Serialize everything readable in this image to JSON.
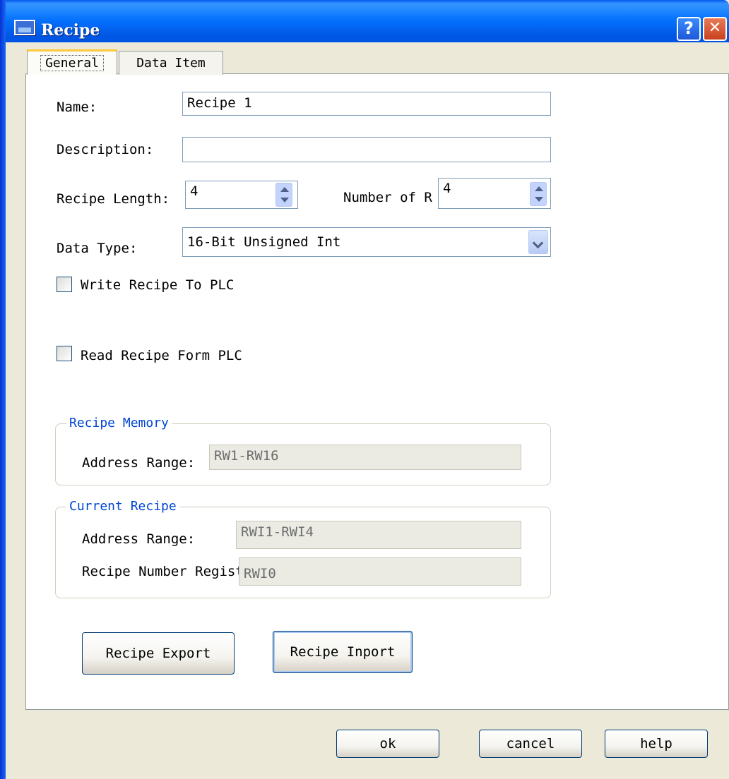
{
  "window": {
    "title": "Recipe",
    "help_glyph": "?",
    "close_glyph": "✕"
  },
  "tabs": [
    {
      "label": "General"
    },
    {
      "label": "Data Item"
    }
  ],
  "form": {
    "name_label": "Name:",
    "name_value": "Recipe 1",
    "description_label": "Description:",
    "description_value": "",
    "recipe_length_label": "Recipe Length:",
    "recipe_length_value": "4",
    "number_label": "Number of R",
    "number_value": "4",
    "data_type_label": "Data Type:",
    "data_type_value": "16-Bit Unsigned Int",
    "write_checkbox_label": "Write Recipe To PLC",
    "write_checked": false,
    "read_checkbox_label": "Read Recipe Form PLC",
    "read_checked": false
  },
  "recipe_memory": {
    "title": "Recipe Memory",
    "address_range_label": "Address Range:",
    "address_range_value": "RW1-RW16"
  },
  "current_recipe": {
    "title": "Current Recipe",
    "address_range_label": "Address Range:",
    "address_range_value": "RWI1-RWI4",
    "number_register_label": "Recipe Number Regist",
    "number_register_value": "RWI0"
  },
  "actions": {
    "export_label": "Recipe Export",
    "import_label": "Recipe Inport"
  },
  "footer": {
    "ok_label": "ok",
    "cancel_label": "cancel",
    "help_label": "help"
  },
  "colors": {
    "titlebar": "#0054e3",
    "group_title": "#0046d5",
    "dialog_bg": "#ece9d8"
  }
}
